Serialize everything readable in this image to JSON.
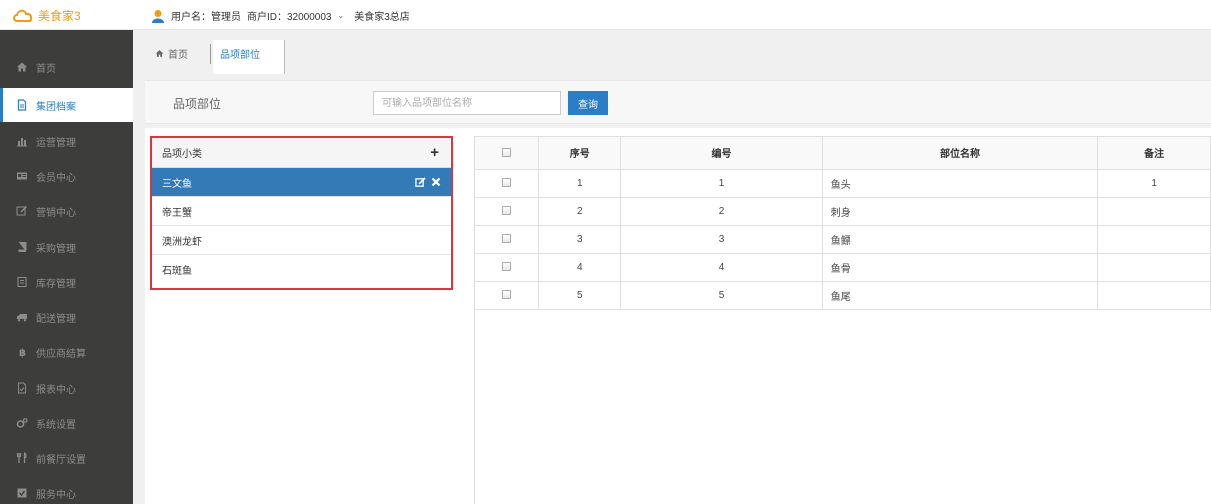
{
  "app": {
    "logo_text": "美食家3"
  },
  "user": {
    "username": "用户名：管理员",
    "merchant_id": "商户ID：32000003",
    "store": "美食家3总店"
  },
  "sidebar": {
    "items": [
      {
        "label": "首页",
        "icon": "home-icon"
      },
      {
        "label": "集团档案",
        "icon": "file-icon",
        "active": true
      },
      {
        "label": "运营管理",
        "icon": "bar-chart-icon"
      },
      {
        "label": "会员中心",
        "icon": "id-card-icon"
      },
      {
        "label": "营销中心",
        "icon": "edit-icon"
      },
      {
        "label": "采购管理",
        "icon": "book-icon"
      },
      {
        "label": "库存管理",
        "icon": "box-icon"
      },
      {
        "label": "配送管理",
        "icon": "truck-icon"
      },
      {
        "label": "供应商结算",
        "icon": "currency-icon"
      },
      {
        "label": "报表中心",
        "icon": "report-icon"
      },
      {
        "label": "系统设置",
        "icon": "gears-icon"
      },
      {
        "label": "前餐厅设置",
        "icon": "utensils-icon"
      },
      {
        "label": "服务中心",
        "icon": "checkbox-icon"
      }
    ]
  },
  "tabs": {
    "home": "首页",
    "active": "品项部位"
  },
  "filter": {
    "label": "品项部位",
    "placeholder": "可输入品项部位名称",
    "query_button": "查询"
  },
  "categories": {
    "header": "品项小类",
    "items": [
      "三文鱼",
      "帝王蟹",
      "澳洲龙虾",
      "石斑鱼"
    ],
    "selected_index": 0
  },
  "table": {
    "headers": [
      "序号",
      "编号",
      "部位名称",
      "备注"
    ],
    "rows": [
      {
        "seq": "1",
        "code": "1",
        "name": "鱼头",
        "note": "1"
      },
      {
        "seq": "2",
        "code": "2",
        "name": "刺身",
        "note": ""
      },
      {
        "seq": "3",
        "code": "3",
        "name": "鱼鳔",
        "note": ""
      },
      {
        "seq": "4",
        "code": "4",
        "name": "鱼骨",
        "note": ""
      },
      {
        "seq": "5",
        "code": "5",
        "name": "鱼尾",
        "note": ""
      }
    ]
  },
  "colors": {
    "primary": "#2a7ec8",
    "selected_row": "#337ab7",
    "highlight_border": "#d9363e",
    "sidebar_bg": "#3d3e3c"
  }
}
